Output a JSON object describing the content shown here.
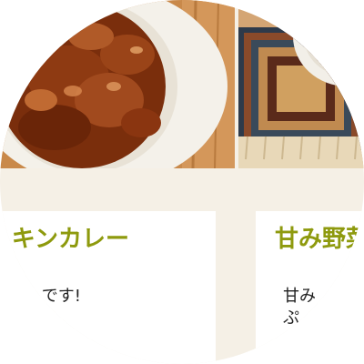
{
  "recipes": [
    {
      "image_icon": "curry-dish-photo",
      "title": "キンカレー",
      "description": "です!"
    },
    {
      "image_icon": "placemat-dish-photo",
      "title": "甘み野菜",
      "description": "甘み",
      "description_line2": "ぷ"
    }
  ],
  "colors": {
    "title": "#8e9a0e",
    "background": "#f5f0e6",
    "card": "#ffffff"
  }
}
